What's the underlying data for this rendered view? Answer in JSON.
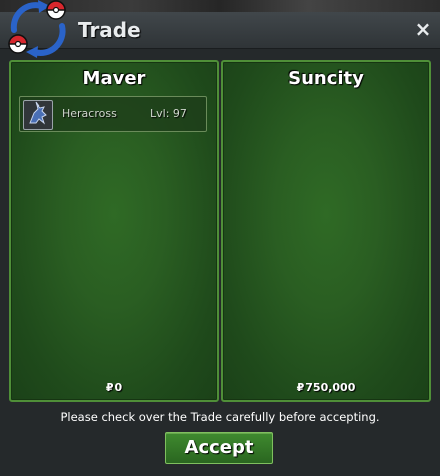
{
  "window": {
    "title": "Trade",
    "close_symbol": "×",
    "logo_icon": "pokeball-swap-icon"
  },
  "left_panel": {
    "player_name": "Maver",
    "items": [
      {
        "icon": "heracross-sprite-icon",
        "name": "Heracross",
        "level": "Lvl: 97"
      }
    ],
    "money_symbol": "₽",
    "money": "0"
  },
  "right_panel": {
    "player_name": "Suncity",
    "items": [],
    "money_symbol": "₽",
    "money": "750,000"
  },
  "footer": {
    "warning": "Please check over the Trade carefully before accepting.",
    "accept_label": "Accept"
  },
  "colors": {
    "panel_green": "#2f6a25",
    "panel_border": "#4f8f38",
    "button_green": "#3f8a2f",
    "titlebar": "#41474b"
  }
}
